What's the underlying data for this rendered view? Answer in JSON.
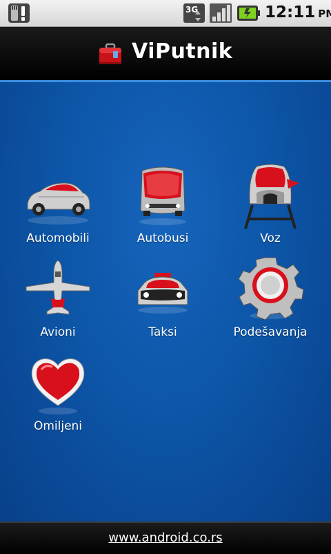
{
  "statusbar": {
    "network": "3G",
    "time": "12:11",
    "ampm": "PM"
  },
  "header": {
    "title": "ViPutnik"
  },
  "menu": [
    {
      "label": "Automobili",
      "icon": "car-icon"
    },
    {
      "label": "Autobusi",
      "icon": "bus-icon"
    },
    {
      "label": "Voz",
      "icon": "train-icon"
    },
    {
      "label": "Avioni",
      "icon": "airplane-icon"
    },
    {
      "label": "Taksi",
      "icon": "taxi-icon"
    },
    {
      "label": "Podešavanja",
      "icon": "gear-icon"
    },
    {
      "label": "Omiljeni",
      "icon": "heart-icon"
    }
  ],
  "footer": {
    "link": "www.android.co.rs"
  },
  "colors": {
    "accent_red": "#d8101c",
    "background_blue": "#0d56a8",
    "bar_black": "#000000"
  }
}
